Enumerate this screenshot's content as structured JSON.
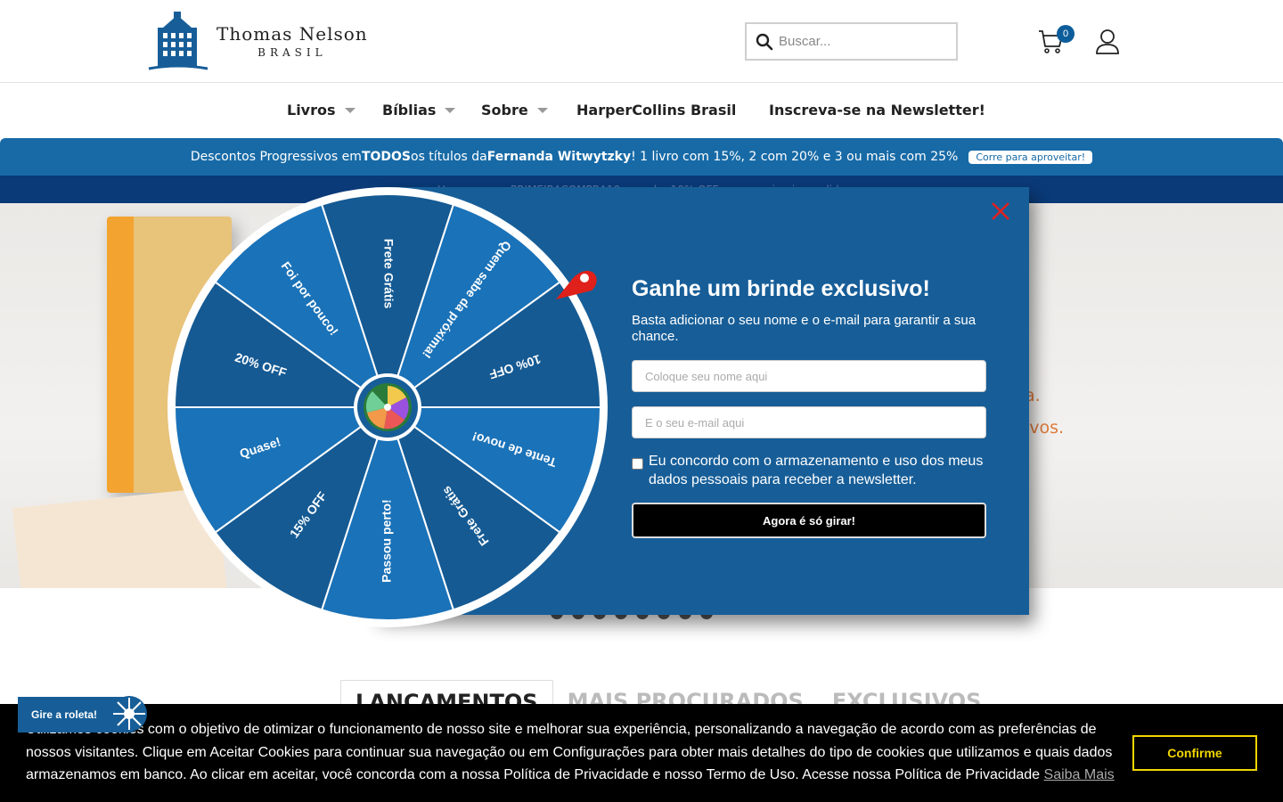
{
  "header": {
    "logo_main": "Thomas Nelson",
    "logo_sub": "BRASIL",
    "search_placeholder": "Buscar...",
    "cart_count": "0"
  },
  "nav": {
    "items": [
      {
        "label": "Livros",
        "dropdown": true
      },
      {
        "label": "Bíblias",
        "dropdown": true
      },
      {
        "label": "Sobre",
        "dropdown": true
      },
      {
        "label": "HarperCollins Brasil",
        "dropdown": false
      },
      {
        "label": "Inscreva-se na Newsletter!",
        "dropdown": false
      }
    ]
  },
  "promo": {
    "text_before": "Descontos Progressivos em ",
    "bold1": "TODOS",
    "text_mid": " os títulos da ",
    "bold2": "Fernanda Witwytzky",
    "text_after": "! 1 livro com 15%, 2 com 20% e 3 ou mais com 25%",
    "cta": "Corre para aproveitar!",
    "secondary": "Use o cupom PRIMEIRACOMPRA10 e ganhe 10% OFF no seu primeiro pedido"
  },
  "hero": {
    "line1": "a.",
    "line2": "ivos."
  },
  "tabs": [
    "LANÇAMENTOS",
    "MAIS PROCURADOS",
    "EXCLUSIVOS"
  ],
  "popup": {
    "title": "Ganhe um brinde exclusivo!",
    "subtitle": "Basta adicionar o seu nome e o e-mail para garantir a sua chance.",
    "name_placeholder": "Coloque seu nome aqui",
    "email_placeholder": "E o seu e-mail aqui",
    "consent": "Eu concordo com o armazenamento e uso dos meus dados pessoais para receber a newsletter.",
    "button": "Agora é só girar!"
  },
  "wheel": {
    "segments": [
      "Frete Grátis",
      "Quem sabe da próxima!",
      "10% OFF",
      "Tente de novo!",
      "Frete Grátis",
      "Passou perto!",
      "15% OFF",
      "Quase!",
      "20% OFF",
      "Foi por pouco!"
    ],
    "colors": [
      "#155a93",
      "#1a72b8"
    ]
  },
  "cookie": {
    "text": "Utilizamos cookies com o objetivo de otimizar o funcionamento de nosso site e melhorar sua experiência, personalizando a navegação de acordo com as preferências de nossos visitantes. Clique em Aceitar Cookies para continuar sua navegação ou em Configurações para obter mais detalhes do tipo de cookies que utilizamos e quais dados armazenamos em banco. Ao clicar em aceitar, você concorda com a nossa Política de Privacidade e nosso Termo de Uso. Acesse nossa Política de Privacidade",
    "link": "Saiba Mais",
    "button": "Confirme"
  },
  "spin_tab": "Gire a roleta!",
  "colors": {
    "brand_blue": "#175e98",
    "promo_blue": "#176aa6",
    "navy": "#0a3a78",
    "cookie_accent": "#f1d600"
  }
}
